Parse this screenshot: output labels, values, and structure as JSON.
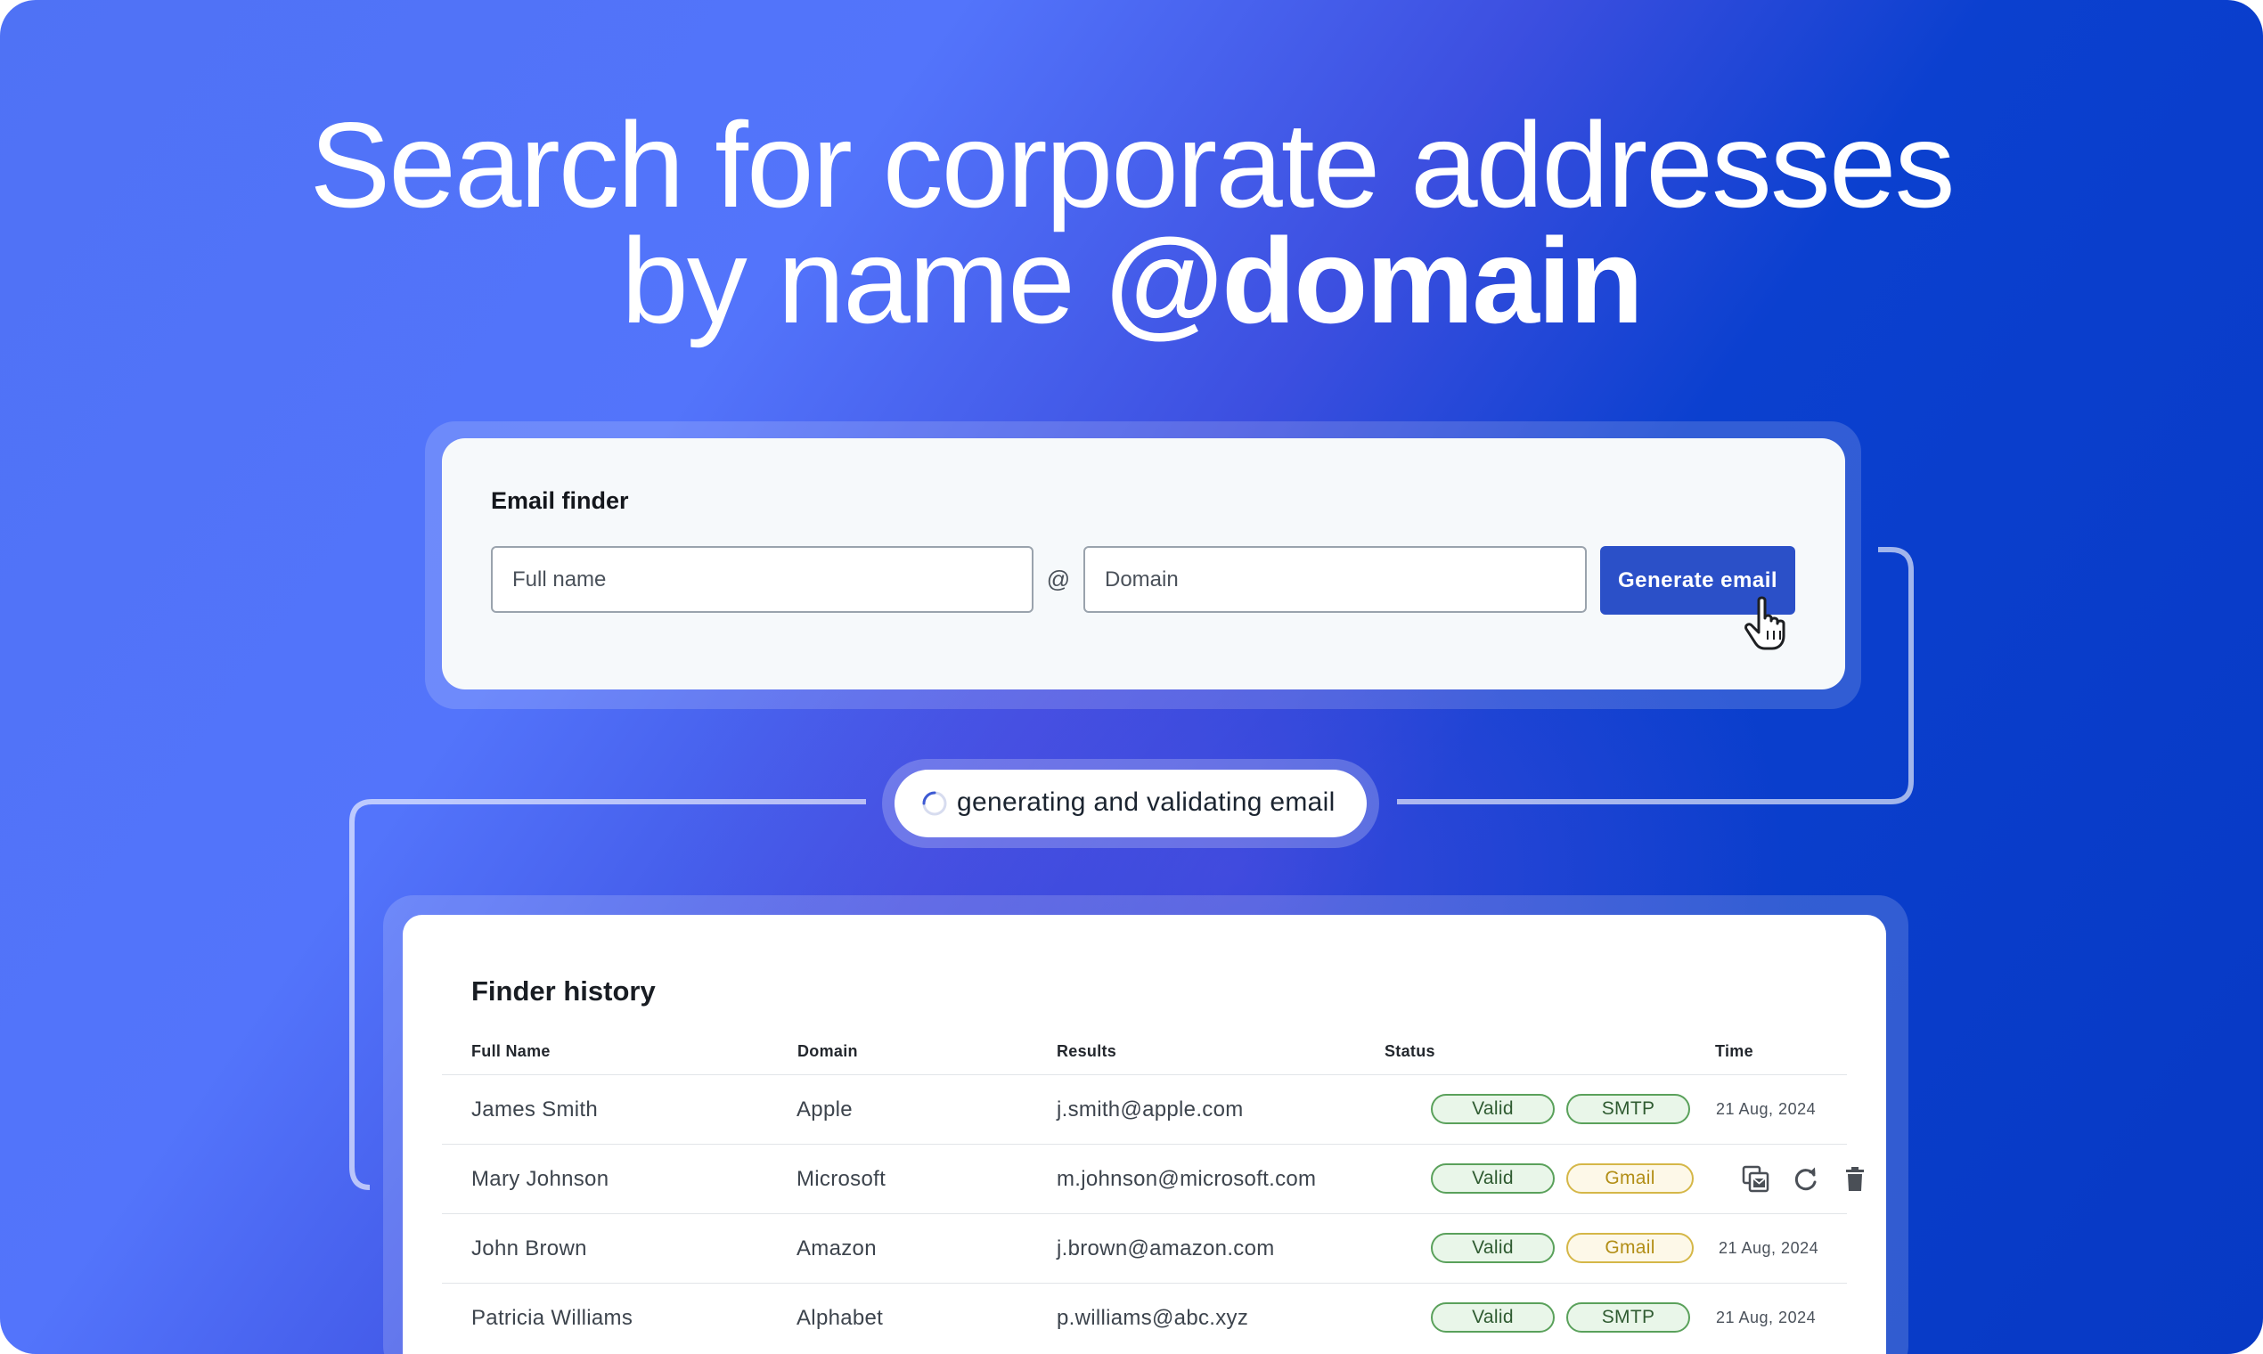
{
  "hero": {
    "line1": "Search for corporate addresses",
    "line2_prefix": "by name ",
    "line2_bold": "@domain"
  },
  "finder": {
    "title": "Email finder",
    "name_placeholder": "Full name",
    "at": "@",
    "domain_placeholder": "Domain",
    "button_label": "Generate email"
  },
  "status_pill": {
    "text": "generating and validating email"
  },
  "history": {
    "title": "Finder history",
    "columns": [
      "Full Name",
      "Domain",
      "Results",
      "Status",
      "Time"
    ],
    "rows": [
      {
        "name": "James Smith",
        "domain": "Apple",
        "result": "j.smith@apple.com",
        "status": "Valid",
        "provider": "SMTP",
        "time": "21 Aug, 2024"
      },
      {
        "name": "Mary Johnson",
        "domain": "Microsoft",
        "result": "m.johnson@microsoft.com",
        "status": "Valid",
        "provider": "Gmail",
        "time": ""
      },
      {
        "name": "John Brown",
        "domain": "Amazon",
        "result": "j.brown@amazon.com",
        "status": "Valid",
        "provider": "Gmail",
        "time": "21 Aug, 2024"
      },
      {
        "name": "Patricia Williams",
        "domain": "Alphabet",
        "result": "p.williams@abc.xyz",
        "status": "Valid",
        "provider": "SMTP",
        "time": "21 Aug, 2024"
      }
    ],
    "row_actions": [
      "copy-email-icon",
      "refresh-icon",
      "trash-icon"
    ]
  },
  "colors": {
    "primary_button": "#2b50c8",
    "valid_green": "#5aa15b",
    "gmail_yellow": "#d5b748",
    "background_dark": "#0739c4",
    "background_light": "#5374fb"
  }
}
